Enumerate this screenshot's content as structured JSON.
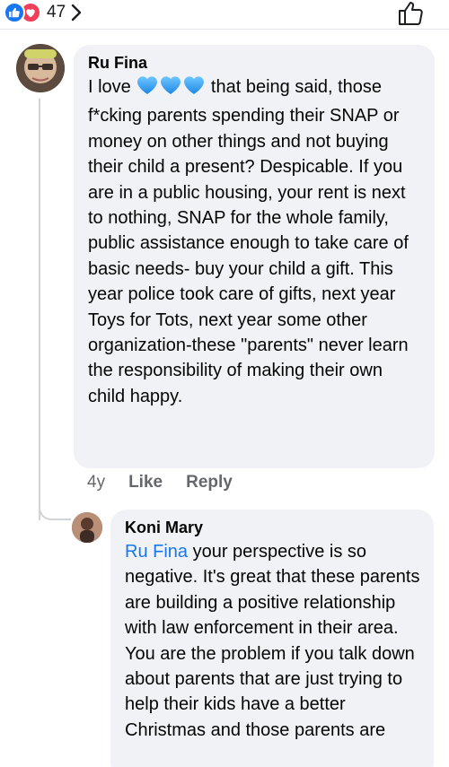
{
  "reactions": {
    "count": "47",
    "types": [
      "like",
      "love"
    ],
    "colors": {
      "like": "#1877f2",
      "love": "#f33e58"
    }
  },
  "like_button": {
    "icon": "thumbs-up-icon"
  },
  "comments": [
    {
      "author": "Ru Fina",
      "text_before_emoji": "I love ",
      "emoji": "blue-hearts-icon",
      "text_after_emoji": " that being said, those f*cking parents spending their SNAP or money on other things and not buying their child a present? Despicable. If you are in a public housing, your rent is next to nothing, SNAP for the whole family, public assistance enough to take care of basic needs- buy your child a gift. This year police took care of gifts, next year Toys for Tots, next year some other organization-these \"parents\" never learn the responsibility of making their own child happy.",
      "time": "4y",
      "like_label": "Like",
      "reply_label": "Reply"
    }
  ],
  "reply": {
    "author": "Koni Mary",
    "mention": "Ru Fina",
    "text": " your perspective is so negative. It's great that these parents are building a positive relationship with law enforcement in their area.  You are the problem if you talk down about parents that are just trying to help their kids have a better Christmas and those parents are"
  }
}
